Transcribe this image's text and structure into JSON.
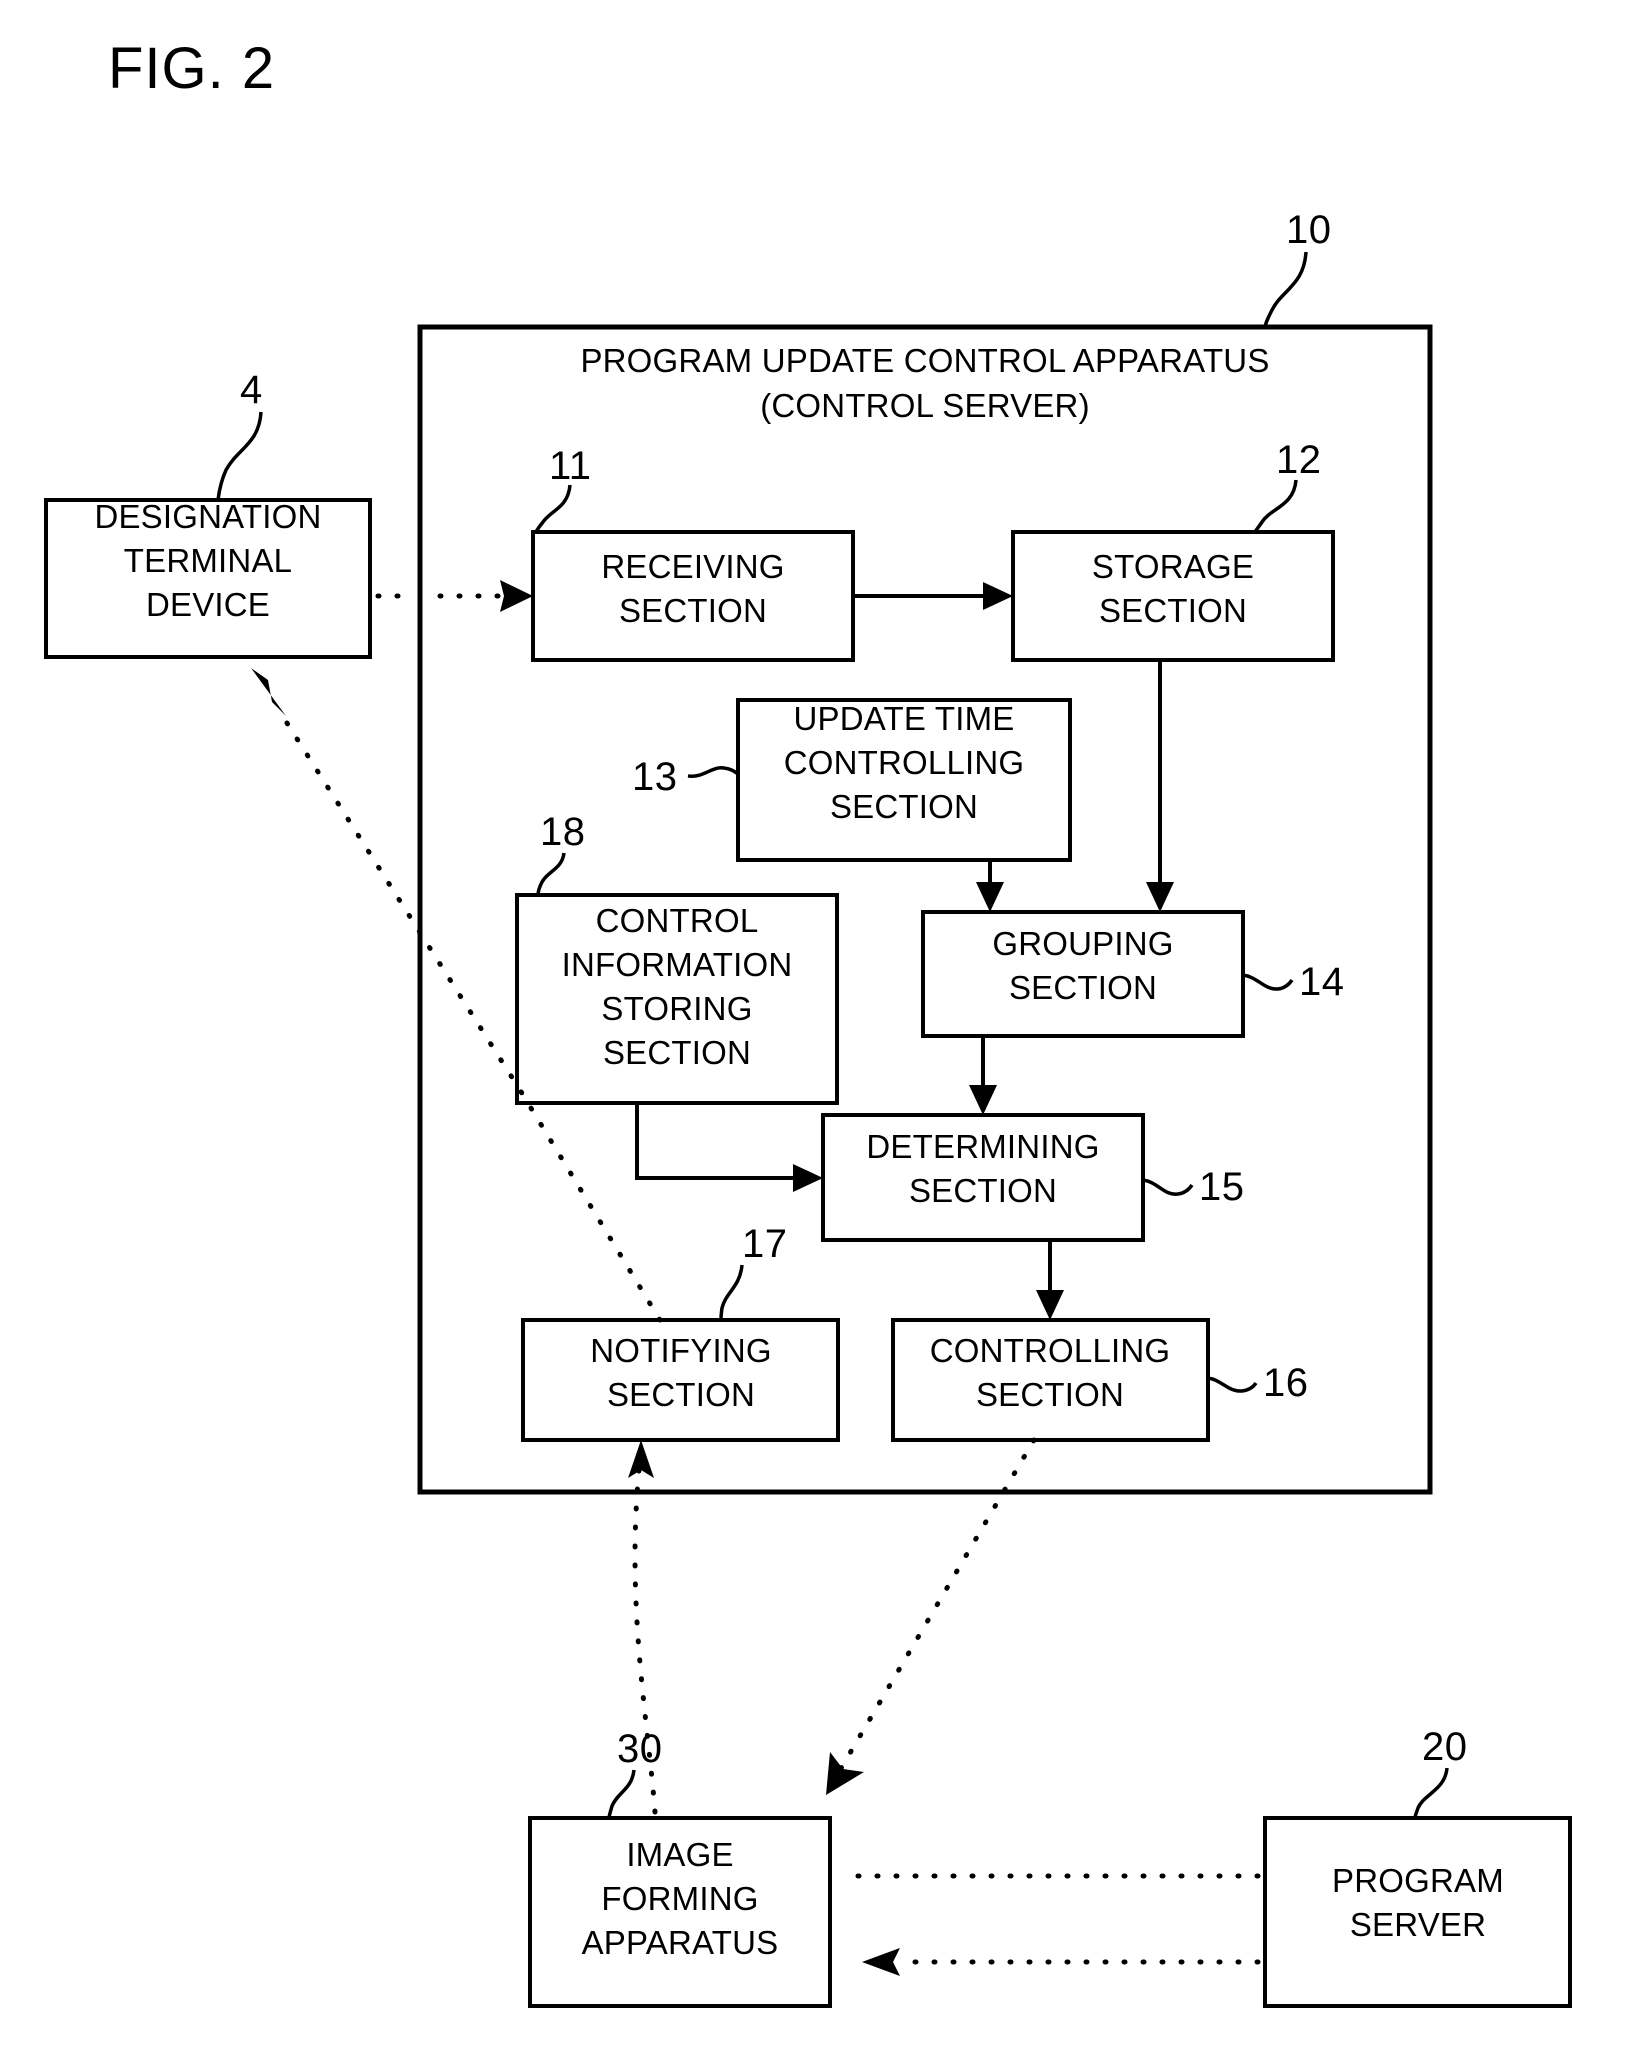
{
  "figure": {
    "title": "FIG. 2"
  },
  "apparatus": {
    "ref": "10",
    "title_line1": "PROGRAM UPDATE CONTROL APPARATUS",
    "title_line2": "(CONTROL SERVER)"
  },
  "blocks": {
    "designation_terminal": {
      "ref": "4",
      "line1": "DESIGNATION",
      "line2": "TERMINAL",
      "line3": "DEVICE"
    },
    "receiving": {
      "ref": "11",
      "line1": "RECEIVING",
      "line2": "SECTION"
    },
    "storage": {
      "ref": "12",
      "line1": "STORAGE",
      "line2": "SECTION"
    },
    "update_time_controlling": {
      "ref": "13",
      "line1": "UPDATE TIME",
      "line2": "CONTROLLING",
      "line3": "SECTION"
    },
    "control_info_storing": {
      "ref": "18",
      "line1": "CONTROL",
      "line2": "INFORMATION",
      "line3": "STORING",
      "line4": "SECTION"
    },
    "grouping": {
      "ref": "14",
      "line1": "GROUPING",
      "line2": "SECTION"
    },
    "determining": {
      "ref": "15",
      "line1": "DETERMINING",
      "line2": "SECTION"
    },
    "controlling": {
      "ref": "16",
      "line1": "CONTROLLING",
      "line2": "SECTION"
    },
    "notifying": {
      "ref": "17",
      "line1": "NOTIFYING",
      "line2": "SECTION"
    },
    "image_forming": {
      "ref": "30",
      "line1": "IMAGE",
      "line2": "FORMING",
      "line3": "APPARATUS"
    },
    "program_server": {
      "ref": "20",
      "line1": "PROGRAM",
      "line2": "SERVER"
    }
  },
  "colors": {
    "ink": "#000000",
    "paper": "#ffffff"
  }
}
